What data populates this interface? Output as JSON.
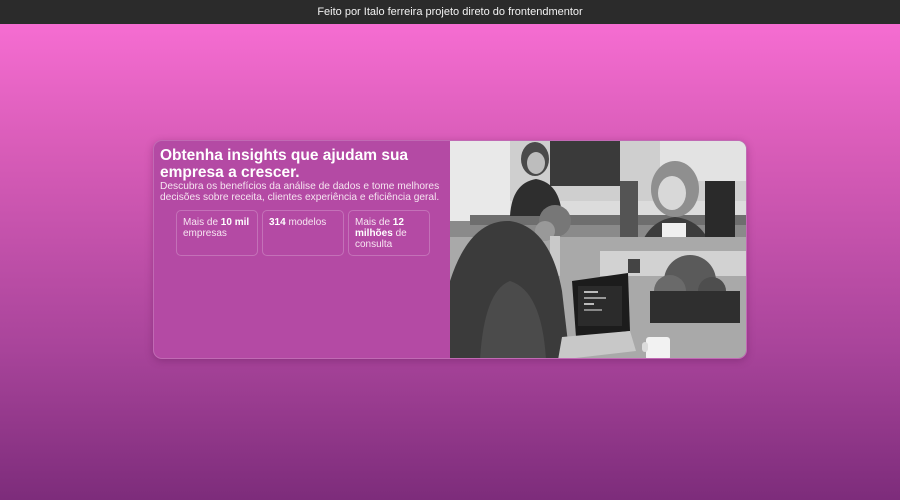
{
  "header": {
    "credit": "Feito por Italo ferreira projeto direto do frontendmentor"
  },
  "card": {
    "title": "Obtenha insights que ajudam sua empresa a crescer.",
    "description": "Descubra os benefícios da análise de dados e tome melhores decisões sobre receita, clientes experiência e eficiência geral.",
    "stats": [
      {
        "prefix": "Mais de",
        "value": "10 mil",
        "suffix": "empresas"
      },
      {
        "prefix": "",
        "value": "314",
        "suffix": "modelos"
      },
      {
        "prefix": "Mais de",
        "value": "12 milhões",
        "suffix": "de consulta"
      }
    ],
    "image_alt": "women working at an office table with laptops"
  },
  "colors": {
    "background_top": "#fb70d6",
    "background_bottom": "#7d2c7b",
    "card": "#b44aa4",
    "topbar": "#2b2b2b"
  }
}
